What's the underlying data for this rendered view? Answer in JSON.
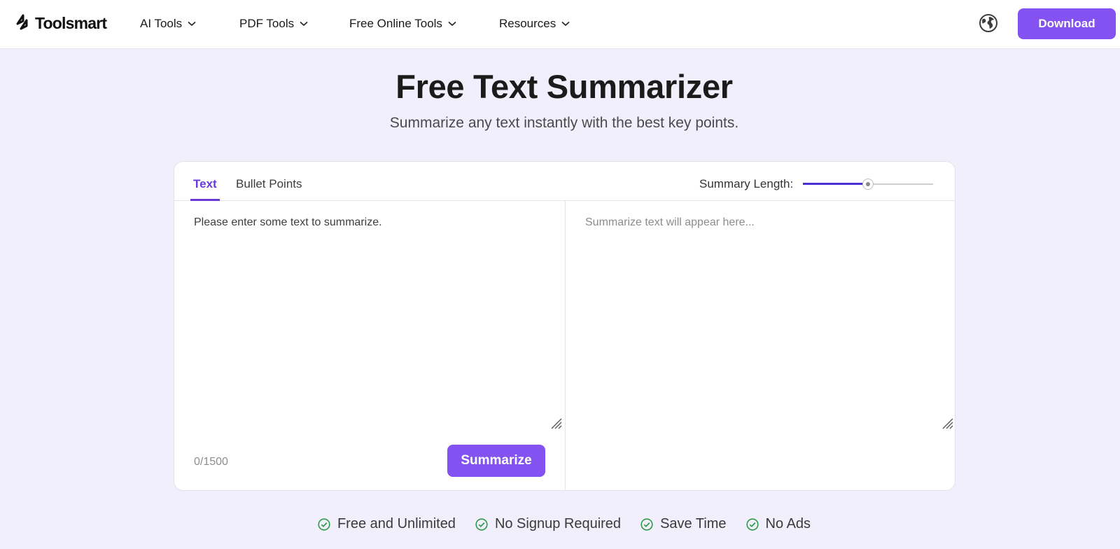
{
  "header": {
    "brand": "Toolsmart",
    "nav": [
      {
        "label": "AI Tools"
      },
      {
        "label": "PDF Tools"
      },
      {
        "label": "Free Online Tools"
      },
      {
        "label": "Resources"
      }
    ],
    "download_label": "Download",
    "globe_icon": "globe-icon"
  },
  "hero": {
    "title": "Free Text Summarizer",
    "subtitle": "Summarize any text instantly with the best key points."
  },
  "tool": {
    "tabs": [
      {
        "label": "Text",
        "active": true
      },
      {
        "label": "Bullet Points",
        "active": false
      }
    ],
    "length_label": "Summary Length:",
    "length_level": 0.5,
    "input_text": "Please enter some text to summarize.",
    "output_placeholder": "Summarize text will appear here...",
    "counter": "0/1500",
    "summarize_label": "Summarize"
  },
  "features": [
    {
      "label": "Free and Unlimited"
    },
    {
      "label": "No Signup Required"
    },
    {
      "label": "Save Time"
    },
    {
      "label": "No Ads"
    }
  ],
  "colors": {
    "accent": "#8452f0",
    "tab_active": "#6a3ad8",
    "check": "#2e9a4a",
    "background": "#f2effc"
  }
}
